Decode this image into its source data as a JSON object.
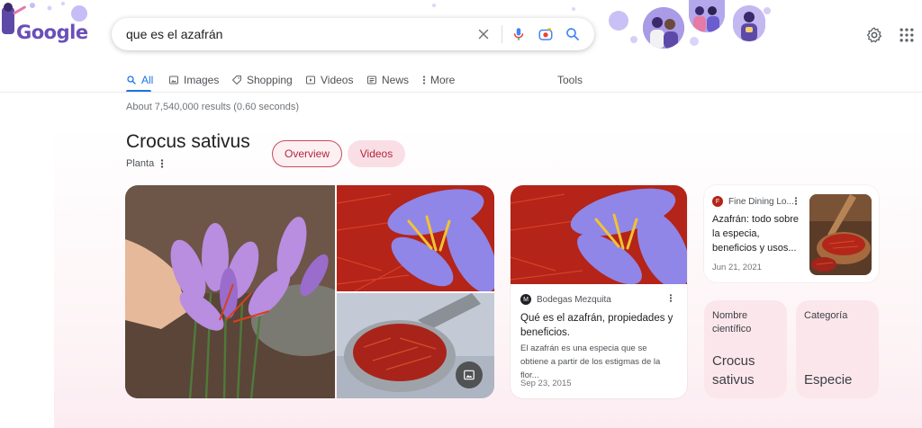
{
  "logo": {
    "text": "Google"
  },
  "search": {
    "query": "que es el azafrán"
  },
  "tabs": [
    {
      "label": "All",
      "icon": "search-icon"
    },
    {
      "label": "Images",
      "icon": "image-icon"
    },
    {
      "label": "Shopping",
      "icon": "tag-icon"
    },
    {
      "label": "Videos",
      "icon": "play-icon"
    },
    {
      "label": "News",
      "icon": "newspaper-icon"
    },
    {
      "label": "More",
      "icon": "more-vertical-icon"
    }
  ],
  "tools_label": "Tools",
  "results_stats": "About 7,540,000 results (0.60 seconds)",
  "knowledge_panel": {
    "title": "Crocus sativus",
    "subtitle": "Planta",
    "chips": [
      {
        "label": "Overview"
      },
      {
        "label": "Videos"
      }
    ]
  },
  "article_card": {
    "source": "Bodegas Mezquita",
    "title": "Qué es el azafrán, propiedades y beneficios.",
    "snippet": "El azafrán es una especia que se obtiene a partir de los estigmas de la flor...",
    "date": "Sep 23, 2015"
  },
  "small_card": {
    "source": "Fine Dining Lo...",
    "title": "Azafrán: todo sobre la especia, beneficios y usos...",
    "date": "Jun 21, 2021"
  },
  "facts": [
    {
      "label": "Nombre científico",
      "value": "Crocus sativus"
    },
    {
      "label": "Categoría",
      "value": "Especie"
    }
  ],
  "colors": {
    "accent": "#1a73e8",
    "chip_text": "#b3263e",
    "fact_bg": "#fbe6ec"
  }
}
